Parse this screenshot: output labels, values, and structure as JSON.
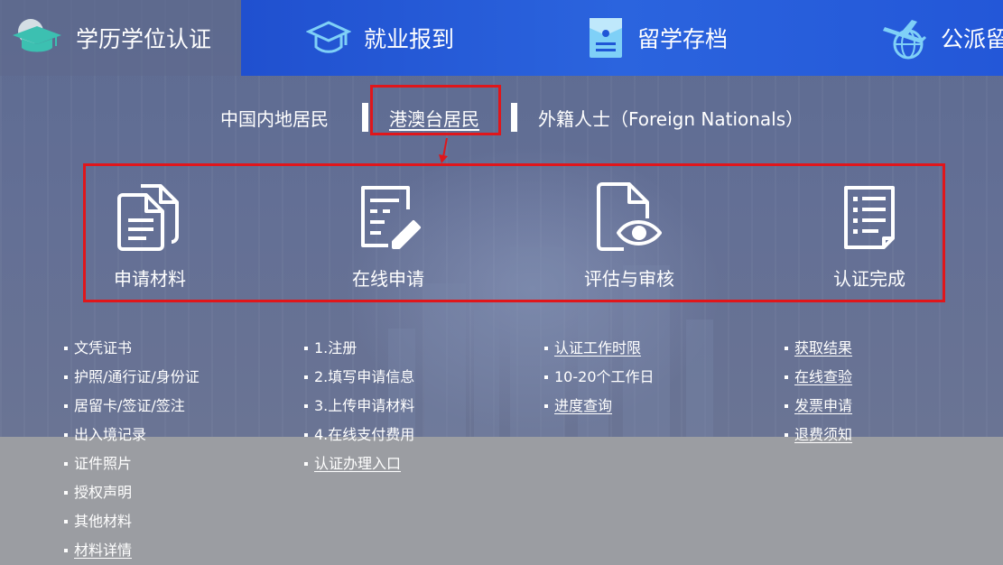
{
  "nav": {
    "tabs": [
      {
        "label": "学历学位认证",
        "icon": "graduation-cap-icon"
      },
      {
        "label": "就业报到",
        "icon": "mortarboard-outline-icon"
      },
      {
        "label": "留学存档",
        "icon": "archive-document-icon"
      },
      {
        "label": "公派留学",
        "icon": "airplane-globe-icon"
      }
    ]
  },
  "resident_tabs": [
    {
      "label": "中国内地居民"
    },
    {
      "label": "港澳台居民"
    },
    {
      "label": "外籍人士（Foreign Nationals）"
    }
  ],
  "steps": [
    {
      "label": "申请材料",
      "icon": "documents-icon"
    },
    {
      "label": "在线申请",
      "icon": "form-edit-icon"
    },
    {
      "label": "评估与审核",
      "icon": "document-eye-icon"
    },
    {
      "label": "认证完成",
      "icon": "checklist-icon"
    }
  ],
  "columns": {
    "materials": [
      "文凭证书",
      "护照/通行证/身份证",
      "居留卡/签证/签注",
      "出入境记录",
      "证件照片",
      "授权声明",
      "其他材料",
      "材料详情"
    ],
    "apply": [
      "1.注册",
      "2.填写申请信息",
      "3.上传申请材料",
      "4.在线支付费用",
      "认证办理入口"
    ],
    "review": [
      "认证工作时限",
      "10-20个工作日",
      "进度查询"
    ],
    "complete": [
      "获取结果",
      "在线查验",
      "发票申请",
      "退费须知"
    ]
  },
  "colors": {
    "nav_blue": "#1f56d6",
    "highlight_red": "#e0161b",
    "hero_bg": "#5d6b91",
    "page_gray": "#9b9da2"
  }
}
